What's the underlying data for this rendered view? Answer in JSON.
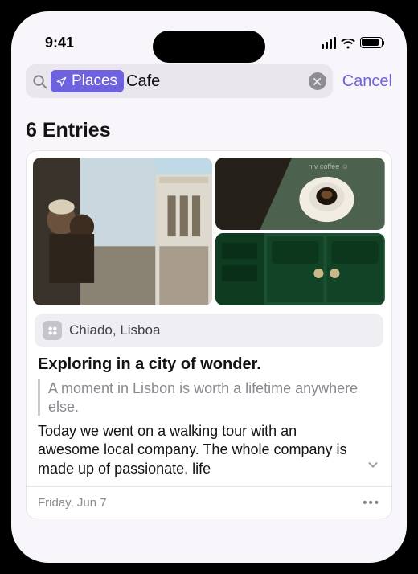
{
  "status": {
    "time": "9:41"
  },
  "search": {
    "token_label": "Places",
    "query": "Cafe",
    "cancel_label": "Cancel"
  },
  "results": {
    "heading": "6 Entries"
  },
  "entry": {
    "location": "Chiado, Lisboa",
    "title": "Exploring in a city of wonder.",
    "quote": "A moment in Lisbon is worth a lifetime anywhere else.",
    "body": "Today we went on a walking tour with an awesome local company. The whole company is made up of passionate, life",
    "date": "Friday, Jun 7"
  }
}
